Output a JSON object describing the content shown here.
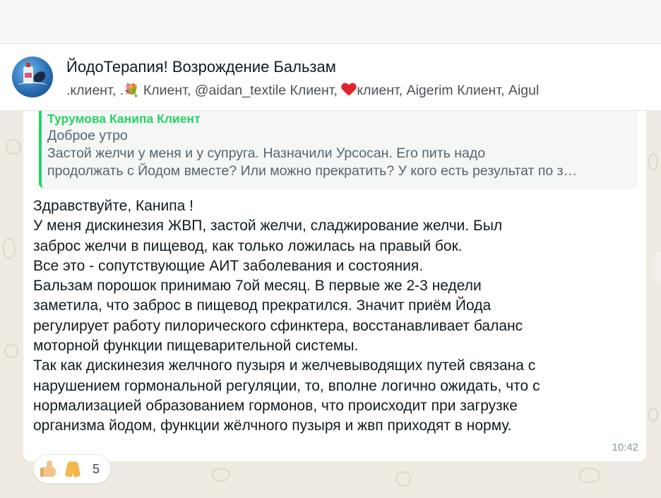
{
  "header": {
    "title": "ЙодоТерапия! Возрождение Бальзам",
    "subtitle_before_flower": ".клиент, .",
    "subtitle_flower": "💐",
    "subtitle_middle": " Клиент, @aidan_textile Клиент, ",
    "subtitle_after_heart": "клиент, Aigerim Клиент, Aigul"
  },
  "quote": {
    "author": "Турумова Канипа Клиент",
    "lines": [
      "Доброе утро",
      "Застой желчи у меня и у супруга. Назначили Урсосан. Его пить надо",
      "продолжать с Йодом вместе? Или можно прекратить? У кого есть результат по з…"
    ]
  },
  "message": {
    "lines": [
      "Здравствуйте, Канипа !",
      "У меня дискинезия ЖВП, застой желчи, сладжирование желчи. Был",
      "заброс желчи в пищевод, как только ложилась на правый бок.",
      "Все это - сопутствующие АИТ заболевания и состояния.",
      "Бальзам порошок принимаю 7ой месяц. В первые же 2-3 недели",
      "заметила, что заброс в пищевод прекратился. Значит приём Йода",
      "регулирует работу пилорического сфинктера,  восстанавливает баланс",
      "моторной функции пищеварительной системы.",
      "Так как дискинезия желчного пузыря и желчевыводящих путей связана с",
      "нарушением гормональной регуляции, то, вполне логично ожидать, что с",
      "нормализацией образованием гормонов, что происходит при загрузке",
      "организма йодом, функции жёлчного пузыря и жвп приходят в норму."
    ],
    "time": "10:42"
  },
  "reactions": {
    "icons": [
      "thumbs-up-icon",
      "folded-hands-icon"
    ],
    "count": "5"
  },
  "colors": {
    "quote_accent": "#25d366",
    "heart": "#e0242c",
    "chat_background": "#efeae2"
  }
}
